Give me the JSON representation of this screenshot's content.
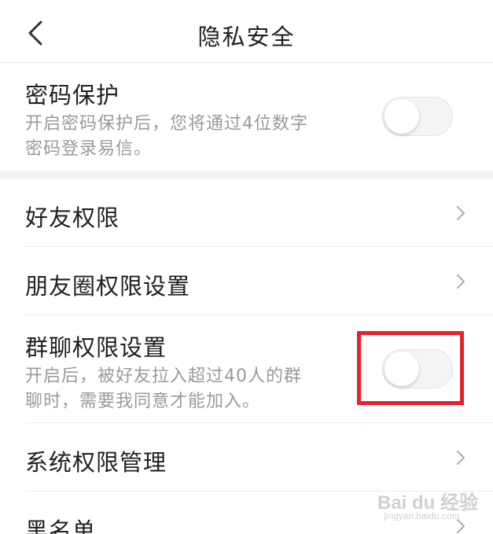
{
  "header": {
    "back_icon": "chevron-left-icon",
    "title": "隐私安全"
  },
  "password_protection": {
    "title": "密码保护",
    "desc_line1": "开启密码保护后，您将通过4位数字",
    "desc_line2": "密码登录易信。",
    "enabled": false
  },
  "friend_permissions": {
    "title": "好友权限",
    "icon": "chevron-right-icon"
  },
  "moments_permissions": {
    "title": "朋友圈权限设置",
    "icon": "chevron-right-icon"
  },
  "group_chat_permissions": {
    "title": "群聊权限设置",
    "desc_line1": "开启后，被好友拉入超过40人的群",
    "desc_line2": "聊时，需要我同意才能加入。",
    "enabled": false
  },
  "system_permissions": {
    "title": "系统权限管理",
    "icon": "chevron-right-icon"
  },
  "blacklist": {
    "title": "黑名单",
    "icon": "chevron-right-icon"
  },
  "watermark": {
    "brand": "Bai du 经验",
    "sub": "jingyan.baidu.com"
  },
  "colors": {
    "highlight": "#e5212b",
    "toggle_off": "#f4f4f4",
    "secondary_text": "#9a9a9a"
  }
}
